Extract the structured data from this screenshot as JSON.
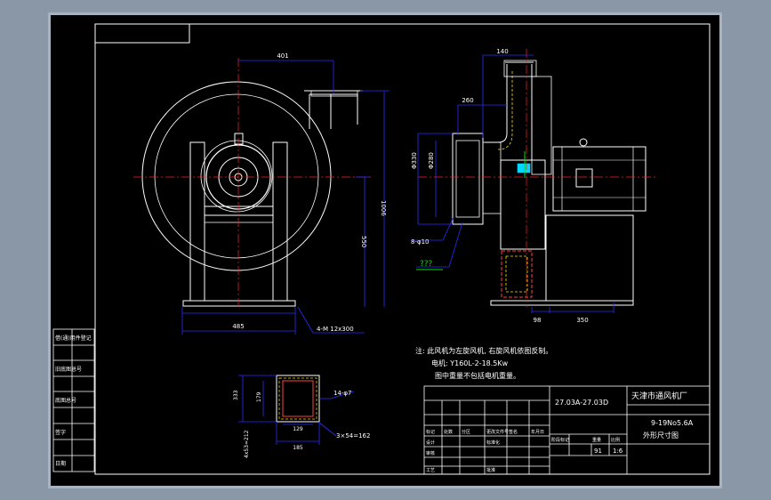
{
  "colors": {
    "frame_bg": "#a7b3c1",
    "canvas": "#000000",
    "line": "#ffffff",
    "dim": "#2b2bff",
    "center": "#ff2020",
    "body": "#ffffff",
    "accent_red": "#ff4040",
    "accent_yellow": "#ffe000",
    "accent_green": "#00e000",
    "accent_cyan": "#00d8ff"
  },
  "dimensions": {
    "d401": "401",
    "d140": "140",
    "d260": "260",
    "d1006": "1006",
    "d550": "550",
    "d485": "485",
    "d98": "98",
    "d350": "350",
    "phi330": "Φ330",
    "phi280": "Φ280",
    "bolts_8": "8-φ10",
    "qqq": "???",
    "base_holes": "4-M 12x300",
    "d333": "333",
    "d179": "179",
    "d129": "129",
    "d185": "185",
    "d4x53": "4x53=212",
    "holes_14": "14-φ7",
    "holes_3x54": "3×54=162"
  },
  "notes": {
    "line1": "注: 此风机为左旋风机, 右旋风机依图反制。",
    "line2": "电机: Y160L-2-18.5Kw",
    "line3": "图中重量不包括电机重量。"
  },
  "title_block": {
    "drawing_no": "27.03A-27.03D",
    "company": "天津市通风机厂",
    "model": "9-19No5.6A",
    "drawing_name": "外形尺寸图",
    "scale_count": "91",
    "scale": "1:6",
    "labels_row1": [
      "标记",
      "处数",
      "分区",
      "更改文件号",
      "签名",
      "年月日"
    ],
    "labels_row2": [
      "设计",
      "",
      "标准化",
      ""
    ],
    "labels_row3": [
      "审核",
      ""
    ],
    "labels_row4": [
      "工艺",
      "",
      "批准",
      ""
    ],
    "right_labels": [
      "阶段标记",
      "重量",
      "比例"
    ]
  },
  "left_strip": {
    "labels": [
      "借(通)用件登记",
      "",
      "旧底图总号",
      "",
      "底图总号",
      "",
      "签字",
      "",
      "日期"
    ]
  }
}
